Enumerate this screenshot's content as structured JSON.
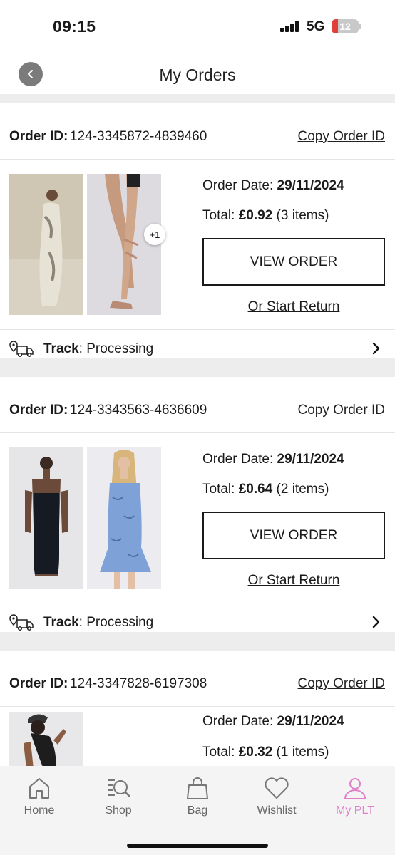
{
  "status_bar": {
    "time": "09:15",
    "network": "5G",
    "battery": "12",
    "battery_level": 0.12
  },
  "header": {
    "title": "My Orders"
  },
  "labels": {
    "order_id": "Order ID:",
    "copy_order_id": "Copy Order ID",
    "order_date": "Order Date:",
    "total": "Total:",
    "view_order": "VIEW ORDER",
    "start_return": "Or Start Return",
    "track": "Track"
  },
  "orders": [
    {
      "id": "124-3345872-4839460",
      "date": "29/11/2024",
      "total": "£0.92",
      "items_text": "(3 items)",
      "status": ": Processing",
      "more_items": "+1",
      "product_images": [
        "white-floral-maxi-dress",
        "nude-strappy-heels"
      ]
    },
    {
      "id": "124-3343563-4636609",
      "date": "29/11/2024",
      "total": "£0.64",
      "items_text": "(2 items)",
      "status": ": Processing",
      "product_images": [
        "black-denim-bandeau-dress",
        "blue-floral-ruffle-dress"
      ]
    },
    {
      "id": "124-3347828-6197308",
      "date": "29/11/2024",
      "total": "£0.32",
      "items_text": "(1 items)",
      "product_images": [
        "black-top-cap"
      ]
    }
  ],
  "nav": {
    "items": [
      {
        "label": "Home",
        "icon": "home-icon"
      },
      {
        "label": "Shop",
        "icon": "shop-search-icon"
      },
      {
        "label": "Bag",
        "icon": "bag-icon"
      },
      {
        "label": "Wishlist",
        "icon": "heart-icon"
      },
      {
        "label": "My PLT",
        "icon": "user-icon",
        "active": true
      }
    ],
    "active_color": "#e07fc8"
  }
}
